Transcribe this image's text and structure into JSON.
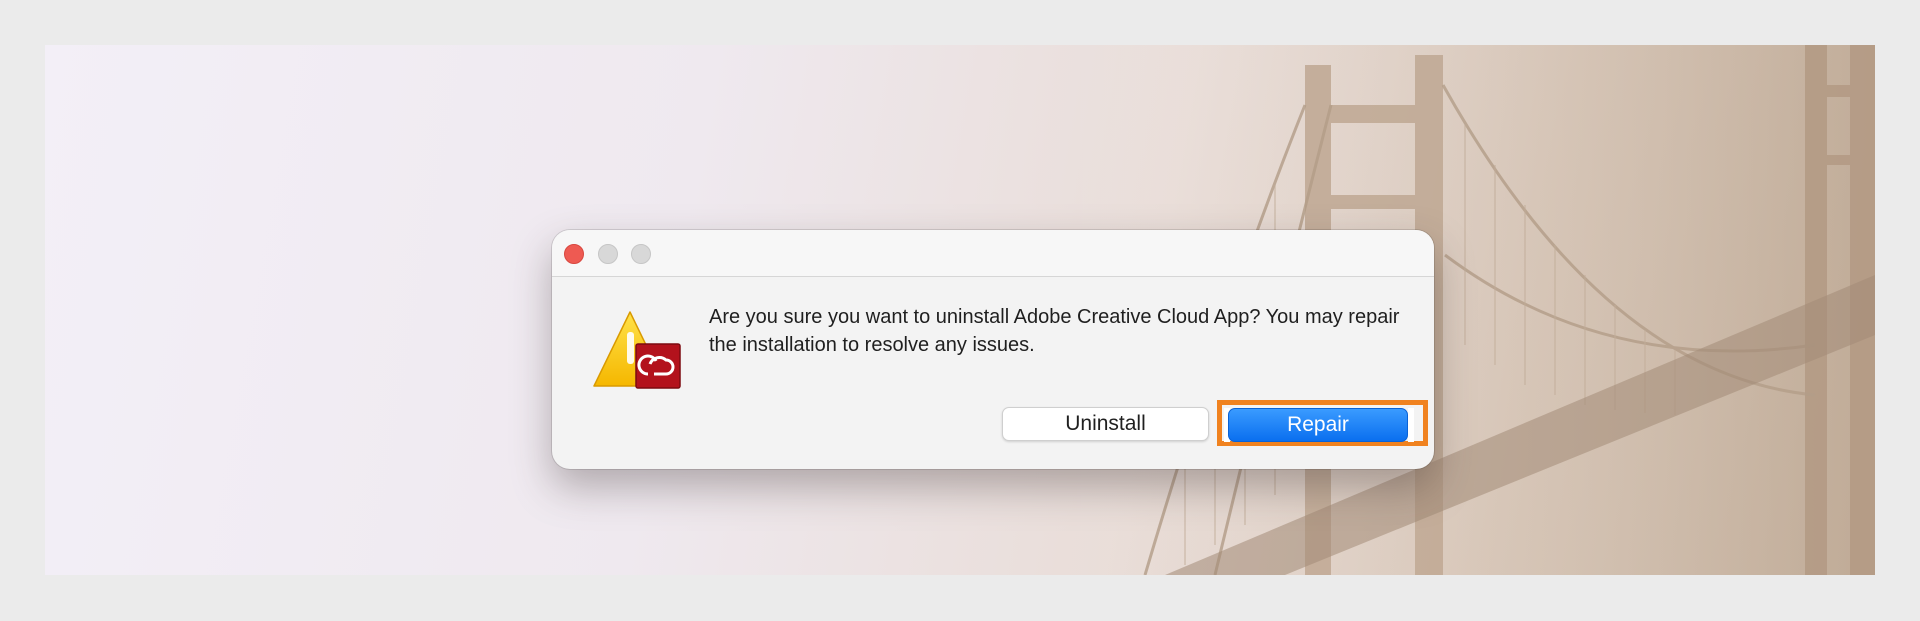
{
  "dialog": {
    "message": "Are you sure you want to uninstall Adobe Creative Cloud App? You may repair the installation to resolve any issues.",
    "icon": "warning-creative-cloud-icon",
    "buttons": {
      "uninstall_label": "Uninstall",
      "repair_label": "Repair"
    },
    "window_controls": [
      "close-icon",
      "minimize-icon",
      "zoom-icon"
    ]
  },
  "colors": {
    "accent_blue": "#0a6fef",
    "highlight_orange": "#f0821f",
    "close_red": "#ee5a52"
  }
}
